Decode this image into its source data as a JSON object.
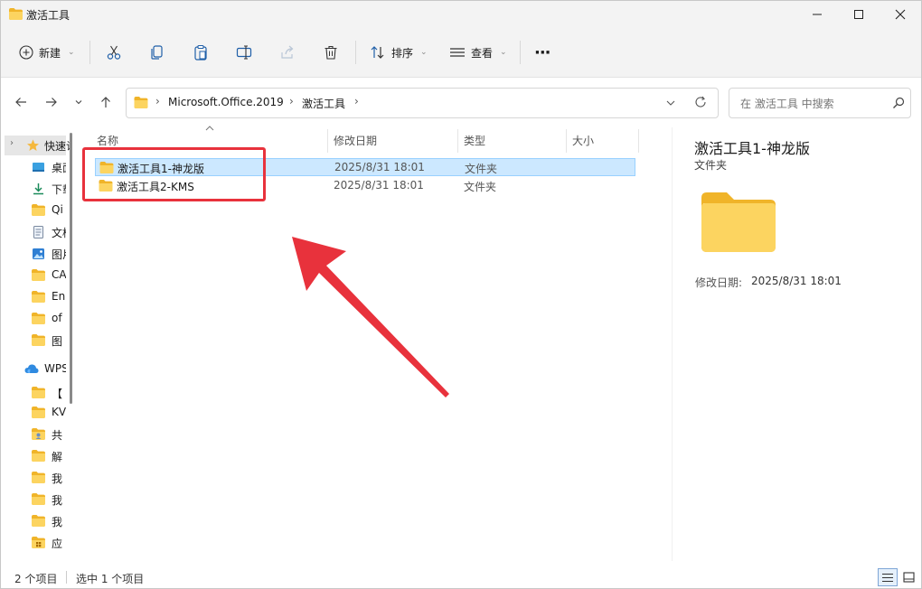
{
  "window": {
    "title": "激活工具"
  },
  "toolbar": {
    "new_label": "新建",
    "sort_label": "排序",
    "view_label": "查看",
    "more_label": "···"
  },
  "address": {
    "segments": [
      "Microsoft.Office.2019",
      "激活工具"
    ],
    "search_placeholder": "在 激活工具 中搜索"
  },
  "navpane": {
    "items": [
      {
        "label": "快速访问",
        "icon": "star-icon"
      },
      {
        "label": "桌面",
        "icon": "desktop-icon"
      },
      {
        "label": "下载",
        "icon": "download-icon"
      },
      {
        "label": "Qi",
        "icon": "folder-icon"
      },
      {
        "label": "文档",
        "icon": "document-icon"
      },
      {
        "label": "图片",
        "icon": "picture-icon"
      },
      {
        "label": "CA",
        "icon": "folder-icon"
      },
      {
        "label": "En",
        "icon": "folder-icon"
      },
      {
        "label": "of",
        "icon": "folder-icon"
      },
      {
        "label": "图",
        "icon": "folder-icon"
      },
      {
        "label": "WPS",
        "icon": "cloud-icon"
      },
      {
        "label": "【",
        "icon": "folder-icon"
      },
      {
        "label": "KV",
        "icon": "folder-icon"
      },
      {
        "label": "共",
        "icon": "shared-folder-icon"
      },
      {
        "label": "解",
        "icon": "folder-icon"
      },
      {
        "label": "我",
        "icon": "folder-icon"
      },
      {
        "label": "我",
        "icon": "folder-icon"
      },
      {
        "label": "我",
        "icon": "folder-icon"
      },
      {
        "label": "应",
        "icon": "app-folder-icon"
      }
    ]
  },
  "filelist": {
    "columns": {
      "name": "名称",
      "modified": "修改日期",
      "type": "类型",
      "size": "大小"
    },
    "rows": [
      {
        "name": "激活工具1-神龙版",
        "modified": "2025/8/31 18:01",
        "type": "文件夹",
        "selected": true
      },
      {
        "name": "激活工具2-KMS",
        "modified": "2025/8/31 18:01",
        "type": "文件夹",
        "selected": false
      }
    ]
  },
  "details": {
    "title": "激活工具1-神龙版",
    "type": "文件夹",
    "modified_label": "修改日期:",
    "modified_value": "2025/8/31 18:01"
  },
  "status": {
    "count": "2 个项目",
    "selection": "选中 1 个项目"
  },
  "colors": {
    "accent": "#0067c0",
    "selection": "#cce8ff",
    "folder": "#f7c444",
    "annotation": "#e8323c"
  }
}
